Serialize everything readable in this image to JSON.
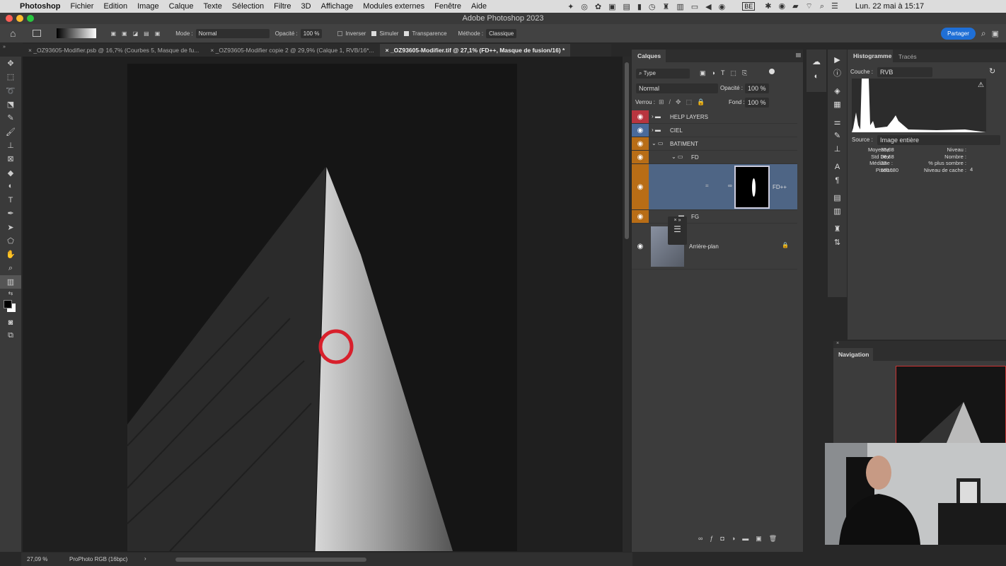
{
  "menubar": {
    "apple": "",
    "app": "Photoshop",
    "items": [
      "Fichier",
      "Edition",
      "Image",
      "Calque",
      "Texte",
      "Sélection",
      "Filtre",
      "3D",
      "Affichage",
      "Modules externes",
      "Fenêtre",
      "Aide"
    ],
    "clock": "Lun. 22 mai à 15:17",
    "keyboard": "BE"
  },
  "window": {
    "title": "Adobe Photoshop 2023"
  },
  "options": {
    "mode_label": "Mode :",
    "mode": "Normal",
    "opacity_label": "Opacité :",
    "opacity": "100 %",
    "invert": "Inverser",
    "simulate": "Simuler",
    "transparency": "Transparence",
    "method_label": "Méthode :",
    "method": "Classique",
    "share": "Partager",
    "invert_checked": false,
    "simulate_checked": true,
    "transparency_checked": true
  },
  "tabs": [
    {
      "label": "_OZ93605-Modifier.psb @ 16,7% (Courbes 5, Masque de fu...",
      "active": false
    },
    {
      "label": "_OZ93605-Modifier copie 2 @ 29,9% (Calque 1, RVB/16*...",
      "active": false
    },
    {
      "label": "_OZ93605-Modifier.tif @ 27,1% (FD++, Masque de fusion/16) *",
      "active": true
    }
  ],
  "status": {
    "zoom": "27,09 %",
    "profile": "ProPhoto RGB (16bpc)",
    "arrow": "›"
  },
  "layers": {
    "tab": "Calques",
    "filter": "Type",
    "blend": "Normal",
    "opacity_label": "Opacité :",
    "opacity": "100 %",
    "lock_label": "Verrou :",
    "fill_label": "Fond :",
    "fill": "100 %",
    "rows": [
      {
        "name": "HELP LAYERS",
        "color": "#b8353f"
      },
      {
        "name": "CIEL",
        "color": "#4a6a9a"
      },
      {
        "name": "BATIMENT",
        "color": "#b86d16"
      },
      {
        "name": "FD",
        "color": "#b86d16"
      },
      {
        "name": "FD++",
        "color": "#b86d16"
      },
      {
        "name": "FG",
        "color": "#b86d16"
      },
      {
        "name": "Arrière-plan",
        "color": ""
      }
    ]
  },
  "histogram": {
    "tab": "Histogramme",
    "tab2": "Tracés",
    "channel_label": "Couche :",
    "channel": "RVB",
    "source_label": "Source :",
    "source": "Image entière",
    "stats": {
      "mean_label": "Moyenne :",
      "mean": "35,08",
      "std_label": "Std Dev :",
      "std": "36,68",
      "median_label": "Médiane :",
      "median": "23",
      "pixels_label": "Pixels :",
      "pixels": "591680",
      "level_label": "Niveau :",
      "count_label": "Nombre :",
      "darker_label": "% plus sombre :",
      "cache_label": "Niveau de cache :",
      "cache": "4"
    }
  },
  "navigation": {
    "tab": "Navigation"
  },
  "colors": {
    "accent": "#1f6fd6",
    "selected_layer": "#4e6585"
  }
}
